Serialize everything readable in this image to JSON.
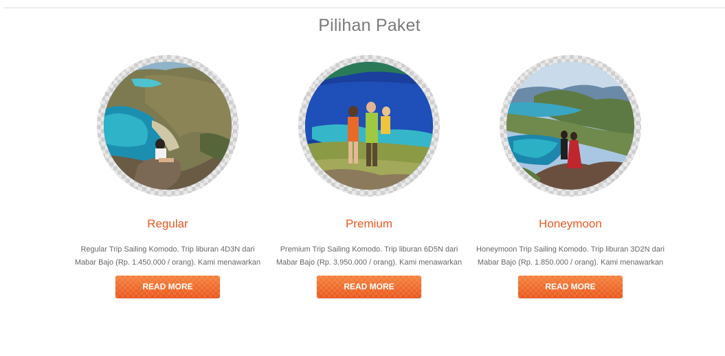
{
  "section": {
    "title": "Pilihan Paket"
  },
  "packages": [
    {
      "name": "Regular",
      "description": "Regular Trip Sailing Komodo. Trip liburan 4D3N dari Mabar Bajo (Rp. 1.450.000 / orang). Kami menawarkan",
      "button_label": "READ MORE",
      "image_alt": "Regular trip photo: hiker on a hilltop overlooking a turquoise bay"
    },
    {
      "name": "Premium",
      "description": "Premium Trip Sailing Komodo. Trip liburan 6D5N dari Mabar Bajo (Rp. 3.950.000 / orang). Kami menawarkan",
      "button_label": "READ MORE",
      "image_alt": "Premium trip photo: family standing on a grassy hill above deep blue sea"
    },
    {
      "name": "Honeymoon",
      "description": "Honeymoon Trip Sailing Komodo. Trip liburan 3D2N dari Mabar Bajo (Rp. 1.850.000 / orang). Kami menawarkan",
      "button_label": "READ MORE",
      "image_alt": "Honeymoon trip photo: couple on a rocky viewpoint over island bays"
    }
  ],
  "colors": {
    "accent": "#e8571f",
    "button": "#f06a2a",
    "title": "#7a7a7a",
    "body_text": "#666666"
  }
}
